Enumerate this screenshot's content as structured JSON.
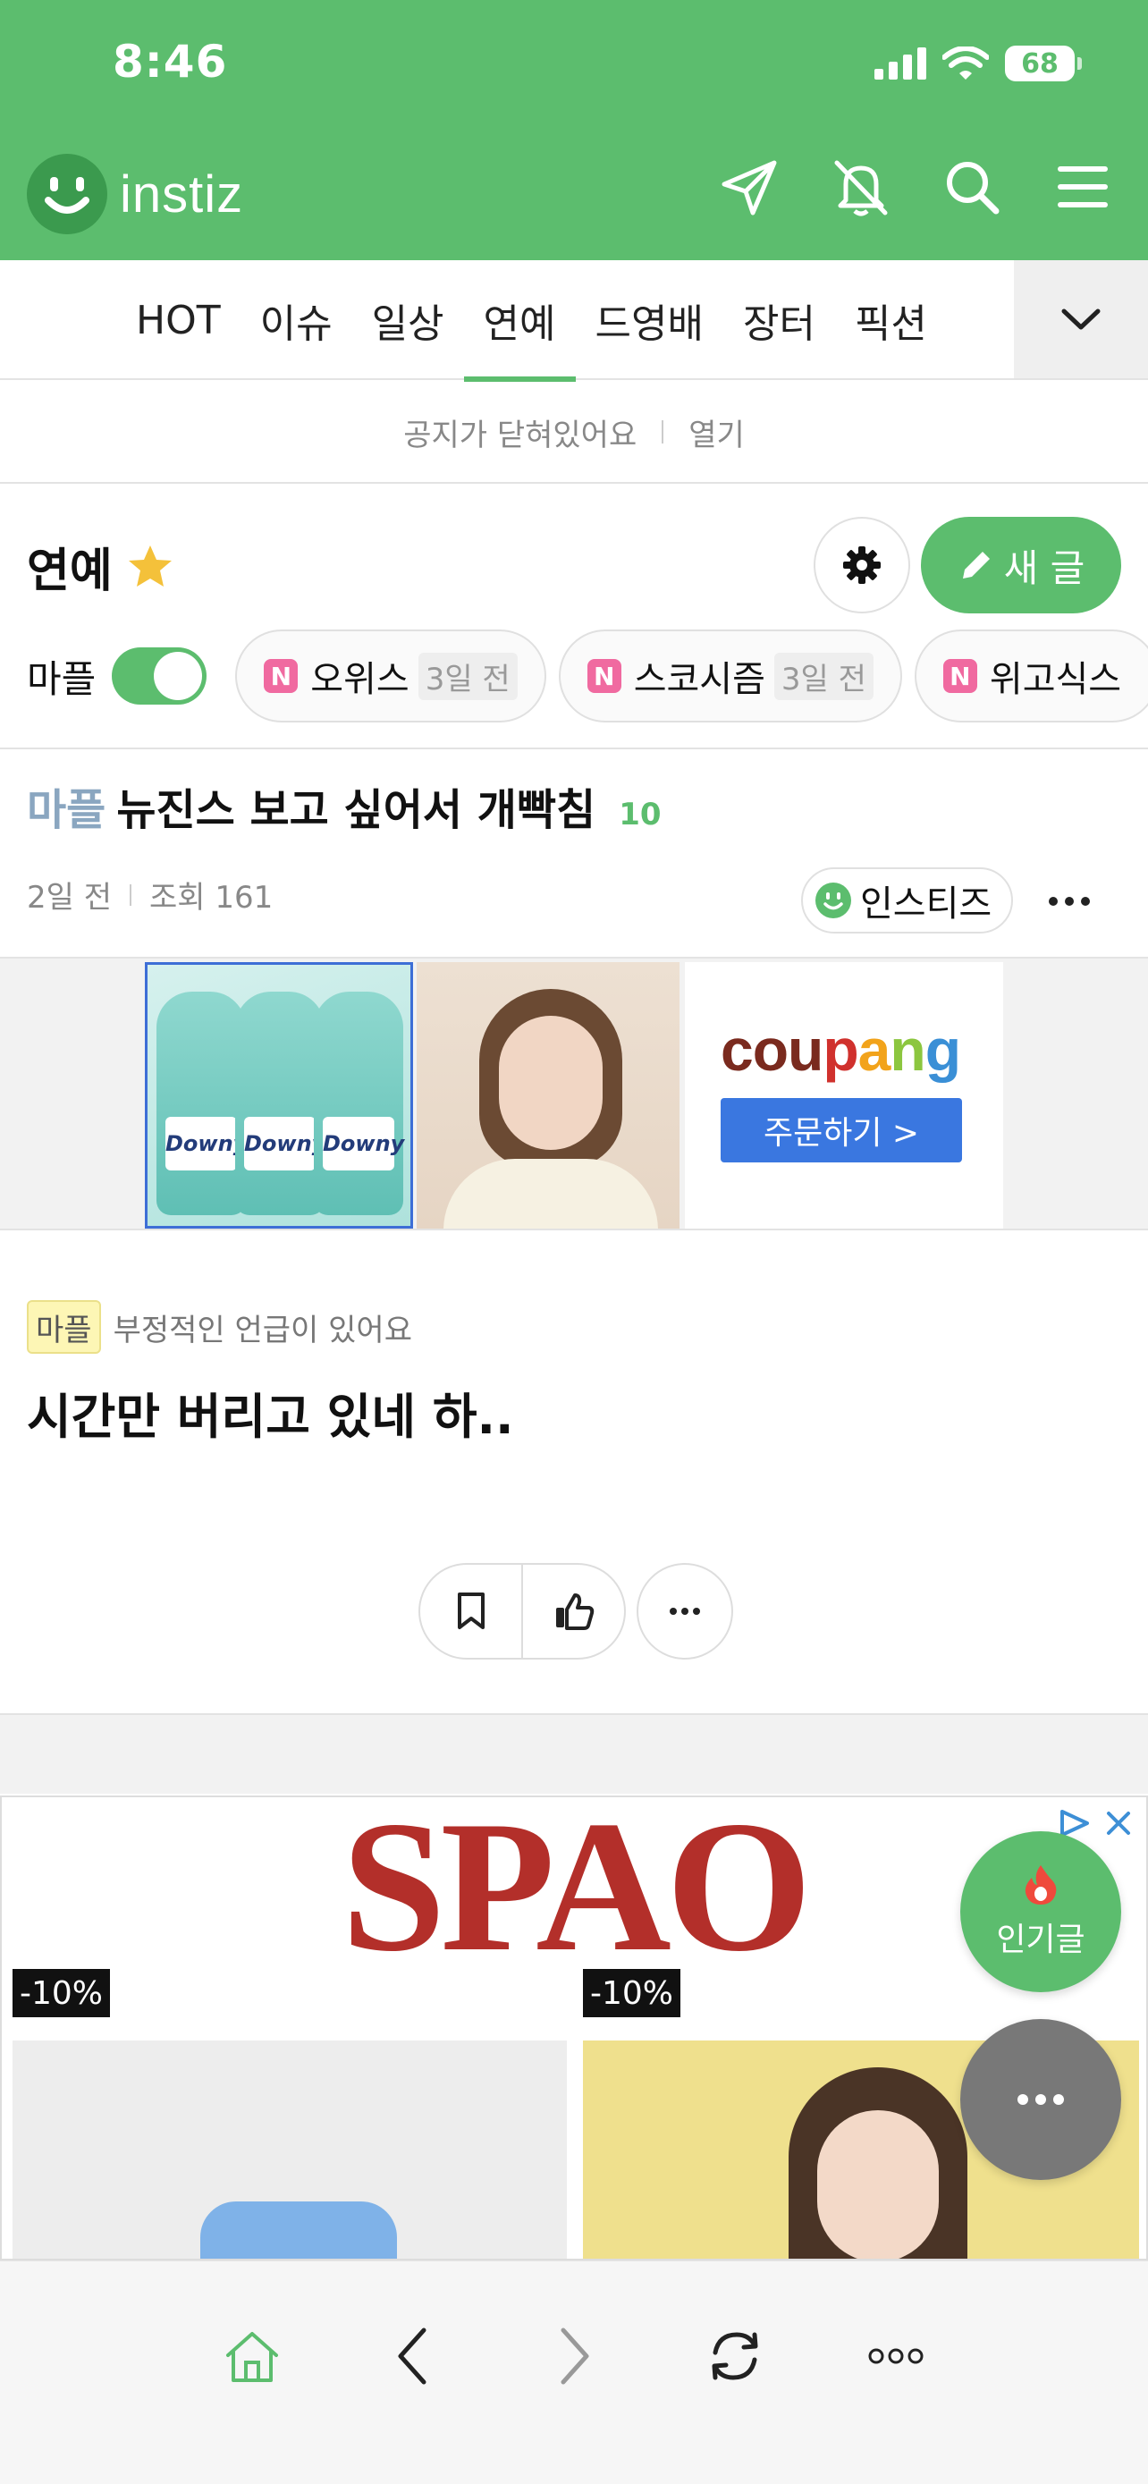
{
  "status_bar": {
    "time": "8:46",
    "battery": "68"
  },
  "header": {
    "logo_text": "instiz",
    "icons": [
      "paper-plane-icon",
      "bell-off-icon",
      "search-icon",
      "menu-icon"
    ]
  },
  "tabs": [
    {
      "label": "HOT",
      "active": false
    },
    {
      "label": "이슈",
      "active": false
    },
    {
      "label": "일상",
      "active": false
    },
    {
      "label": "연예",
      "active": true
    },
    {
      "label": "드영배",
      "active": false
    },
    {
      "label": "장터",
      "active": false
    },
    {
      "label": "픽션",
      "active": false
    }
  ],
  "notice": {
    "text": "공지가 닫혀있어요",
    "open_label": "열기"
  },
  "board": {
    "title": "연예",
    "write_label": "새 글",
    "mp_label": "마플",
    "mp_enabled": true,
    "chips": [
      {
        "badge": "N",
        "title": "오위스",
        "time": "3일 전"
      },
      {
        "badge": "N",
        "title": "스코시즘",
        "time": "3일 전"
      },
      {
        "badge": "N",
        "title": "위고식스",
        "time": ""
      }
    ]
  },
  "post": {
    "category": "마플",
    "title": "뉴진스 보고 싶어서 개빡침",
    "comment_count": "10",
    "time": "2일 전",
    "views": "조회 161",
    "author": "인스티즈",
    "warning_badge": "마플",
    "warning_text": "부정적인 언급이 있어요",
    "body": "시간만 버리고 있네 하.."
  },
  "ad1": {
    "bottle_label": "Downy",
    "brand": "coupang",
    "button_label": "주문하기 >"
  },
  "ad2": {
    "brand": "SPAO",
    "discount_1": "-10%",
    "discount_2": "-10%"
  },
  "fab": {
    "popular_label": "인기글"
  },
  "colors": {
    "brand_green": "#5cbd6e",
    "mp_badge_pink": "#f06aa0",
    "spao_red": "#b32f2a",
    "coupang_button": "#3a77e0"
  }
}
